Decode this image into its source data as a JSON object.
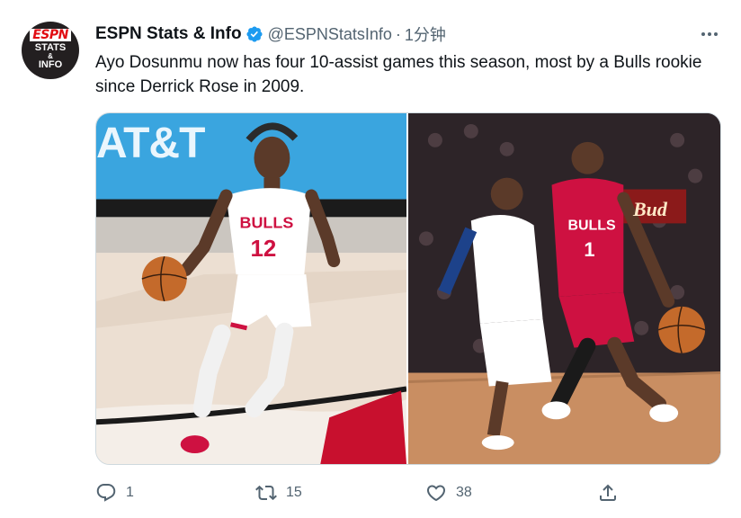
{
  "tweet": {
    "avatar": {
      "line1": "ESPN",
      "line2": "STATS",
      "line3": "&",
      "line4": "INFO"
    },
    "author": {
      "display_name": "ESPN Stats & Info",
      "handle": "@ESPNStatsInfo",
      "separator": "·",
      "time": "1分钟",
      "verified_icon": "verified-badge-icon",
      "verified_color": "#1d9bf0"
    },
    "text": "Ayo Dosunmu now has four 10-assist games this season, most by a Bulls rookie since Derrick Rose in 2009.",
    "media": [
      {
        "overlay_text": "AT&T",
        "jersey_team": "BULLS",
        "jersey_number": "12"
      },
      {
        "overlay_text": "Bud",
        "jersey_team": "BULLS",
        "jersey_number": "1"
      }
    ],
    "actions": {
      "reply": {
        "icon": "reply-icon",
        "count": "1"
      },
      "retweet": {
        "icon": "retweet-icon",
        "count": "15"
      },
      "like": {
        "icon": "heart-icon",
        "count": "38"
      },
      "share": {
        "icon": "share-icon"
      }
    },
    "more_icon": "more-options-icon"
  },
  "colors": {
    "text_primary": "#0f1419",
    "text_secondary": "#536471",
    "border": "#cfd9de",
    "bulls_red": "#ce1141",
    "espn_red": "#e10d13"
  }
}
